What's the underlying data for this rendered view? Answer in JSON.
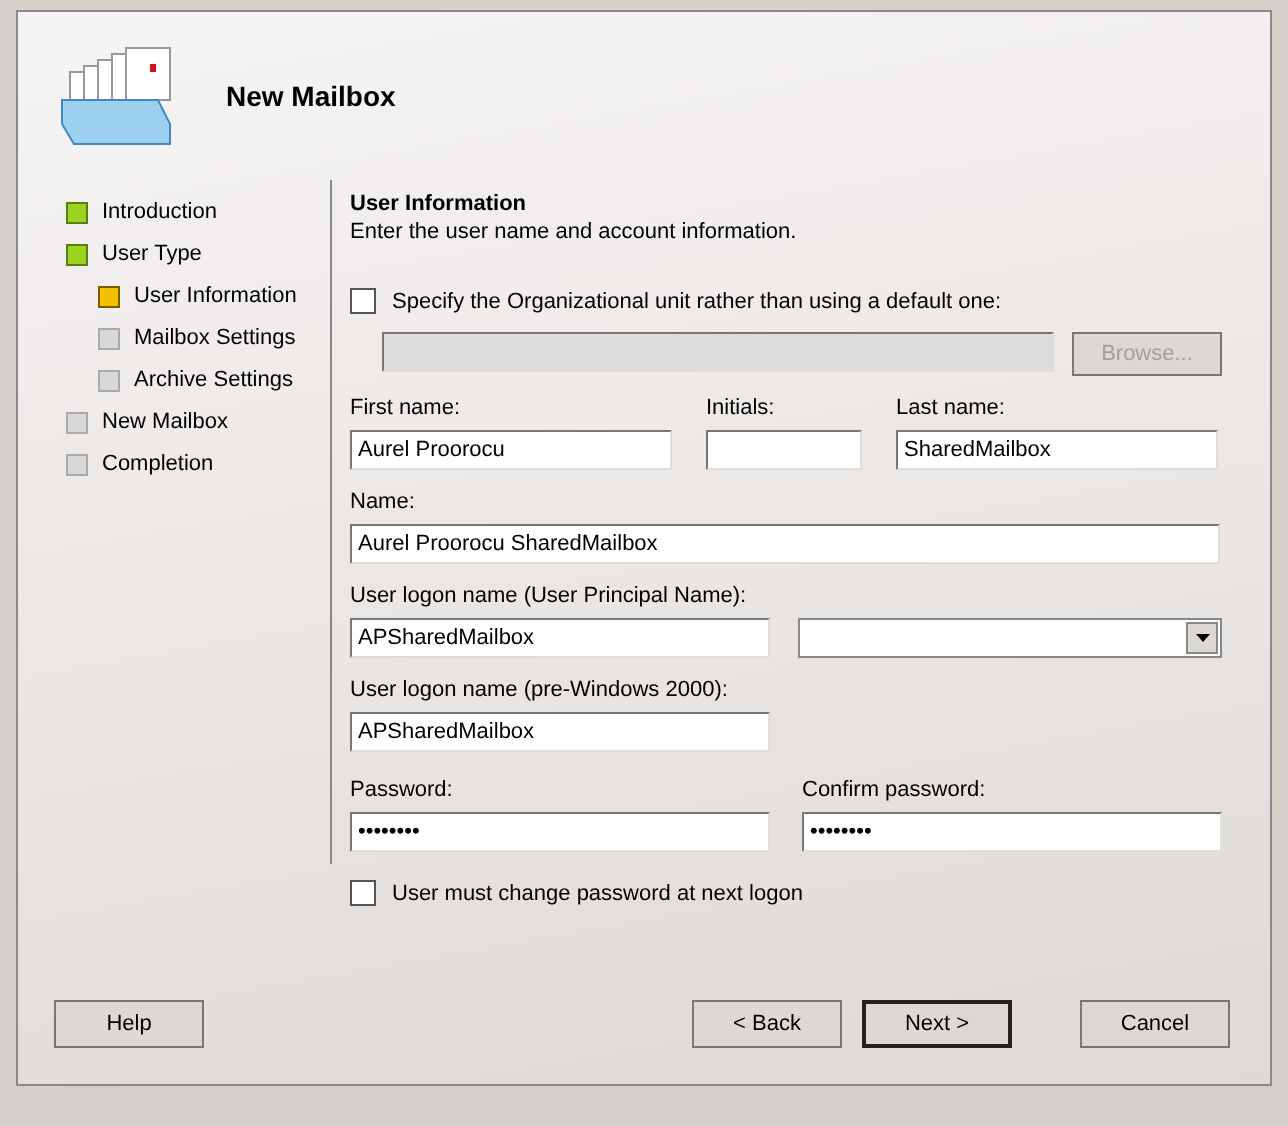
{
  "window": {
    "title": "New Mailbox"
  },
  "steps": [
    {
      "label": "Introduction",
      "completed": true,
      "current": false
    },
    {
      "label": "User Type",
      "completed": true,
      "current": false,
      "children": [
        {
          "label": "User Information",
          "completed": false,
          "current": true
        },
        {
          "label": "Mailbox Settings",
          "completed": false,
          "current": false
        },
        {
          "label": "Archive Settings",
          "completed": false,
          "current": false
        }
      ]
    },
    {
      "label": "New Mailbox",
      "completed": false,
      "current": false
    },
    {
      "label": "Completion",
      "completed": false,
      "current": false
    }
  ],
  "page": {
    "heading": "User Information",
    "description": "Enter the user name and account information."
  },
  "ou_checkbox": {
    "label": "Specify the Organizational unit rather than using a default one:",
    "checked": false
  },
  "ou_field": {
    "disabled": true
  },
  "browse_button": {
    "label": "Browse...",
    "disabled": true
  },
  "first_name": {
    "label": "First name:",
    "value": "Aurel Proorocu"
  },
  "initials": {
    "label": "Initials:"
  },
  "last_name": {
    "label": "Last name:",
    "value": "SharedMailbox"
  },
  "name": {
    "label": "Name:",
    "value": "Aurel Proorocu SharedMailbox"
  },
  "upn": {
    "label": "User logon name (User Principal Name):",
    "value": "APSharedMailbox"
  },
  "pre_win2000": {
    "label": "User logon name (pre-Windows 2000):",
    "value": "APSharedMailbox"
  },
  "password": {
    "label": "Password:",
    "value": "••••••••"
  },
  "confirm_password": {
    "label": "Confirm password:",
    "value": "••••••••"
  },
  "must_change": {
    "label": "User must change password at next logon",
    "checked": false
  },
  "buttons": [
    {
      "label": "Help",
      "kind": "help",
      "default": false
    },
    {
      "label": "< Back",
      "kind": "nav",
      "default": false
    },
    {
      "label": "Next >",
      "kind": "nav",
      "default": true
    },
    {
      "label": "Cancel",
      "kind": "cancel",
      "default": false
    }
  ]
}
